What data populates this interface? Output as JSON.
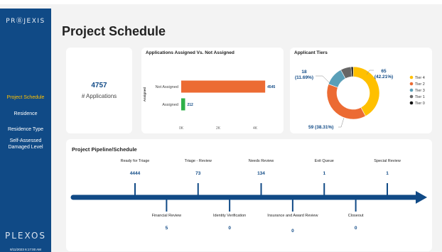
{
  "sidebar": {
    "logo": "PRⒷJEXIS",
    "nav": [
      {
        "label": "Project Schedule",
        "active": true
      },
      {
        "label": "Residence",
        "active": false
      },
      {
        "label": "Residence Type",
        "active": false
      },
      {
        "label": "Self-Assessed Damaged Level",
        "active": false
      }
    ],
    "footer_logo": "PLEXOS",
    "timestamp": "8/11/2023 6:17:00 AM"
  },
  "page_title": "Project Schedule",
  "kpi": {
    "value": "4757",
    "label": "# Applications"
  },
  "bar_card_title": "Applications Assigned Vs. Not Assigned",
  "donut_card_title": "Applicant Tiers",
  "pipeline_card_title": "Project Pipeline/Schedule",
  "colors": {
    "navy": "#104a86",
    "orange": "#ec6b33",
    "green": "#2fb14a",
    "yellow": "#ffc000",
    "teal": "#5a9fb8",
    "gray": "#666666",
    "black": "#111111"
  },
  "chart_data": [
    {
      "type": "bar",
      "orientation": "horizontal",
      "title": "Applications Assigned Vs. Not Assigned",
      "ylabel": "Assigned",
      "categories": [
        "Not Assigned",
        "Assigned"
      ],
      "values": [
        4545,
        212
      ],
      "value_labels": [
        "4545",
        "212"
      ],
      "xticks": [
        "0K",
        "2K",
        "4K"
      ],
      "xlim": [
        0,
        5000
      ],
      "bar_colors": [
        "#ec6b33",
        "#2fb14a"
      ]
    },
    {
      "type": "pie",
      "variant": "donut",
      "title": "Applicant Tiers",
      "slices": [
        {
          "label": "Tier 4",
          "value": 65,
          "display": "65\n(42.21%)",
          "color": "#ffc000"
        },
        {
          "label": "Tier 2",
          "value": 59,
          "display": "59 (38.31%)",
          "color": "#ec6b33"
        },
        {
          "label": "Tier 3",
          "value": 18,
          "display": "18\n(11.69%)",
          "color": "#5a9fb8"
        },
        {
          "label": "Tier 1",
          "value": 10,
          "display": "",
          "color": "#666666"
        },
        {
          "label": "Tier 0",
          "value": 2,
          "display": "",
          "color": "#111111"
        }
      ],
      "legend_order": [
        "Tier 4",
        "Tier 2",
        "Tier 3",
        "Tier 1",
        "Tier 0"
      ],
      "legend": "right"
    }
  ],
  "pipeline": {
    "stages": [
      {
        "name": "Ready for Triage",
        "count": "4444",
        "side": "top"
      },
      {
        "name": "Financial Review",
        "count": "5",
        "side": "bottom"
      },
      {
        "name": "Triage - Review",
        "count": "73",
        "side": "top"
      },
      {
        "name": "Identity Verification",
        "count": "0",
        "side": "bottom"
      },
      {
        "name": "Needs Review",
        "count": "134",
        "side": "top"
      },
      {
        "name": "Insurance and Award Review",
        "count": "0",
        "side": "bottom"
      },
      {
        "name": "Exit Queue",
        "count": "1",
        "side": "top"
      },
      {
        "name": "Closeout",
        "count": "0",
        "side": "bottom"
      },
      {
        "name": "Special Review",
        "count": "1",
        "side": "top"
      }
    ]
  }
}
